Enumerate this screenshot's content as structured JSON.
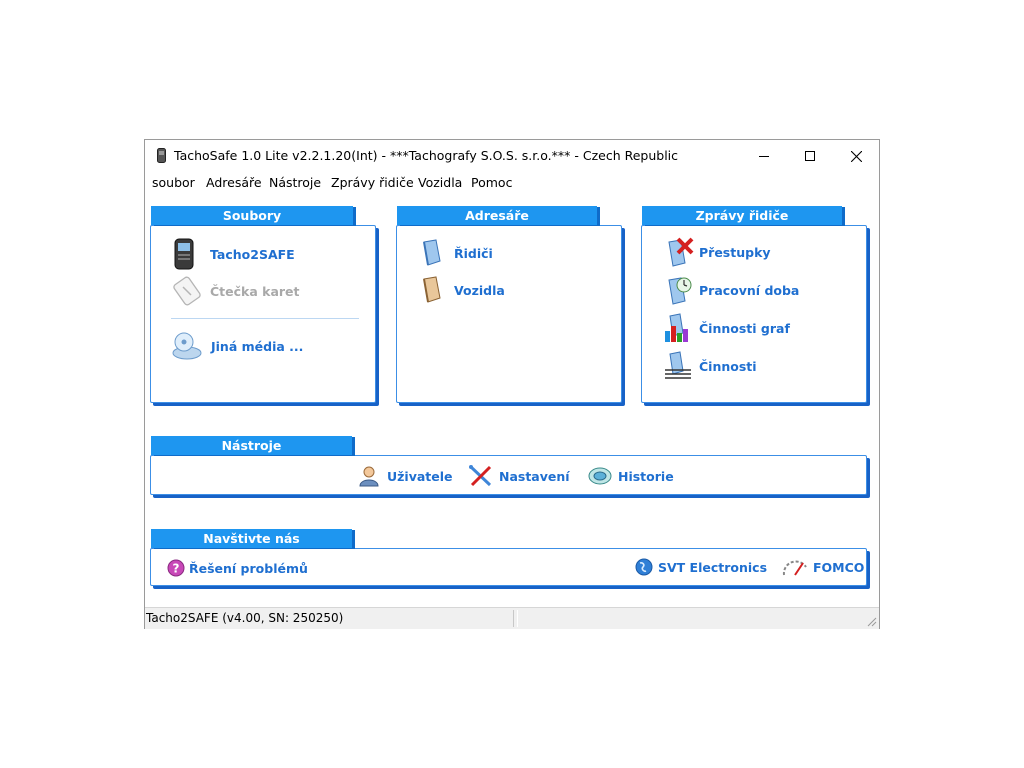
{
  "window": {
    "title": "TachoSafe 1.0 Lite v2.2.1.20(Int) - ***Tachografy S.O.S. s.r.o.*** - Czech Republic"
  },
  "menu": [
    "soubor",
    "Adresáře",
    "Nástroje",
    "Zprávy řidiče",
    "Vozidla",
    "Pomoc"
  ],
  "panels": {
    "soubory": {
      "title": "Soubory",
      "items": [
        "Tacho2SAFE",
        "Čtečka karet",
        "Jiná média ..."
      ]
    },
    "adresare": {
      "title": "Adresáře",
      "items": [
        "Řidiči",
        "Vozidla"
      ]
    },
    "zpravy": {
      "title": "Zprávy řidiče",
      "items": [
        "Přestupky",
        "Pracovní doba",
        "Činnosti graf",
        "Činnosti"
      ]
    },
    "nastroje": {
      "title": "Nástroje",
      "items": [
        "Uživatele",
        "Nastavení",
        "Historie"
      ]
    },
    "navstivte": {
      "title": "Navštivte nás",
      "items": [
        "Řešení problémů",
        "SVT Electronics",
        "FOMCO"
      ]
    }
  },
  "status": {
    "left": "Tacho2SAFE (v4.00, SN: 250250)",
    "right": ""
  },
  "colors": {
    "accent": "#1e96f0",
    "link": "#1f6fd0",
    "border": "#3c8fe6",
    "disabled": "#a9a9a9"
  }
}
